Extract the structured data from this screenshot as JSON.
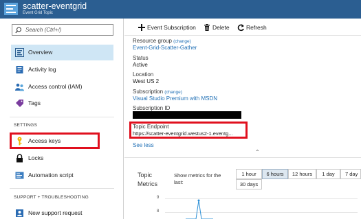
{
  "header": {
    "title": "scatter-eventgrid",
    "subtitle": "Event Grid Topic",
    "bg_color": "#2b5e91"
  },
  "sidebar": {
    "search_placeholder": "Search (Ctrl+/)",
    "items": [
      {
        "label": "Overview",
        "icon": "event-grid-icon",
        "active": true
      },
      {
        "label": "Activity log",
        "icon": "activity-log-icon"
      },
      {
        "label": "Access control (IAM)",
        "icon": "people-icon"
      },
      {
        "label": "Tags",
        "icon": "tag-icon"
      }
    ],
    "settings_header": "SETTINGS",
    "settings_items": [
      {
        "label": "Access keys",
        "icon": "key-icon",
        "highlighted": true
      },
      {
        "label": "Locks",
        "icon": "lock-icon"
      },
      {
        "label": "Automation script",
        "icon": "script-icon"
      }
    ],
    "support_header": "SUPPORT + TROUBLESHOOTING",
    "support_items": [
      {
        "label": "New support request",
        "icon": "support-icon"
      }
    ]
  },
  "toolbar": {
    "event_subscription": "Event Subscription",
    "delete": "Delete",
    "refresh": "Refresh"
  },
  "essentials": {
    "resource_group_label": "Resource group",
    "resource_group_change": "(change)",
    "resource_group_value": "Event-Grid-Scatter-Gather",
    "status_label": "Status",
    "status_value": "Active",
    "location_label": "Location",
    "location_value": "West US 2",
    "subscription_label": "Subscription",
    "subscription_change": "(change)",
    "subscription_value": "Visual Studio Premium with MSDN",
    "subscription_id_label": "Subscription ID",
    "topic_endpoint_label": "Topic Endpoint",
    "topic_endpoint_value": "https://scatter-eventgrid.westus2-1.eventg...",
    "see_less": "See less"
  },
  "metrics": {
    "title_line1": "Topic",
    "title_line2": "Metrics",
    "show_label_line1": "Show metrics for the",
    "show_label_line2": "last:",
    "ranges": [
      "1 hour",
      "6 hours",
      "12 hours",
      "1 day",
      "7 day",
      "30 days"
    ],
    "selected_range": "6 hours",
    "y_ticks": [
      "9",
      "8"
    ]
  },
  "colors": {
    "link": "#1f6fb5",
    "highlight": "#e0101e",
    "active_nav": "#cfe6f5"
  }
}
